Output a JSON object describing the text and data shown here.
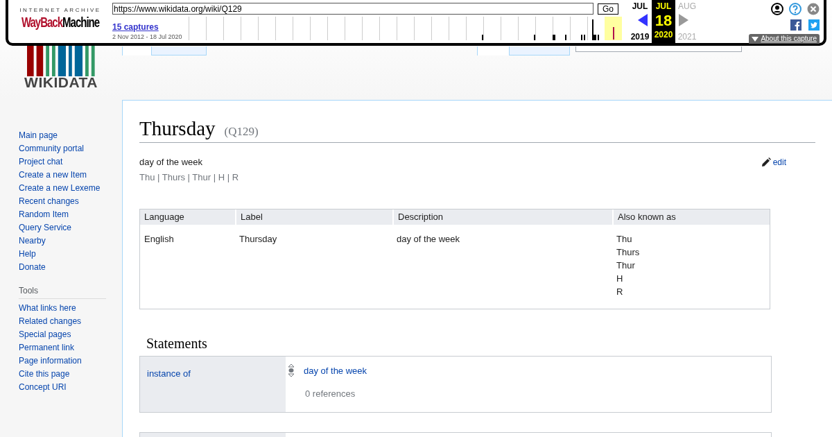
{
  "wayback": {
    "archive_label": "INTERNET ARCHIVE",
    "logo_red": "WayBack",
    "logo_black": "Machine",
    "url": "https://www.wikidata.org/wiki/Q129",
    "go": "Go",
    "captures": "15 captures",
    "range": "2 Nov 2012 - 18 Jul 2020",
    "months": [
      {
        "month": "JUL",
        "year": "2019",
        "selected": false
      },
      {
        "month": "JUL",
        "day": "18",
        "year": "2020",
        "selected": true
      },
      {
        "month": "AUG",
        "year": "2021",
        "selected": false
      }
    ],
    "about": "About this capture"
  },
  "logo": {
    "wordmark": "WIKIDATA"
  },
  "sidebar": {
    "navigation": [
      "Main page",
      "Community portal",
      "Project chat",
      "Create a new Item",
      "Create a new Lexeme",
      "Recent changes",
      "Random Item",
      "Query Service",
      "Nearby",
      "Help",
      "Donate"
    ],
    "tools_heading": "Tools",
    "tools": [
      "What links here",
      "Related changes",
      "Special pages",
      "Permanent link",
      "Page information",
      "Cite this page",
      "Concept URI"
    ]
  },
  "page": {
    "title": "Thursday",
    "id": "(Q129)",
    "description": "day of the week",
    "aliases": "Thu | Thurs | Thur | H | R",
    "edit": "edit",
    "terms_table": {
      "columns": [
        "Language",
        "Label",
        "Description",
        "Also known as"
      ],
      "rows": [
        {
          "language": "English",
          "label": "Thursday",
          "description": "day of the week",
          "aliases": [
            "Thu",
            "Thurs",
            "Thur",
            "H",
            "R"
          ]
        }
      ]
    },
    "statements_heading": "Statements",
    "statements": [
      {
        "property": "instance of",
        "value": "day of the week",
        "references": "0 references"
      }
    ]
  }
}
